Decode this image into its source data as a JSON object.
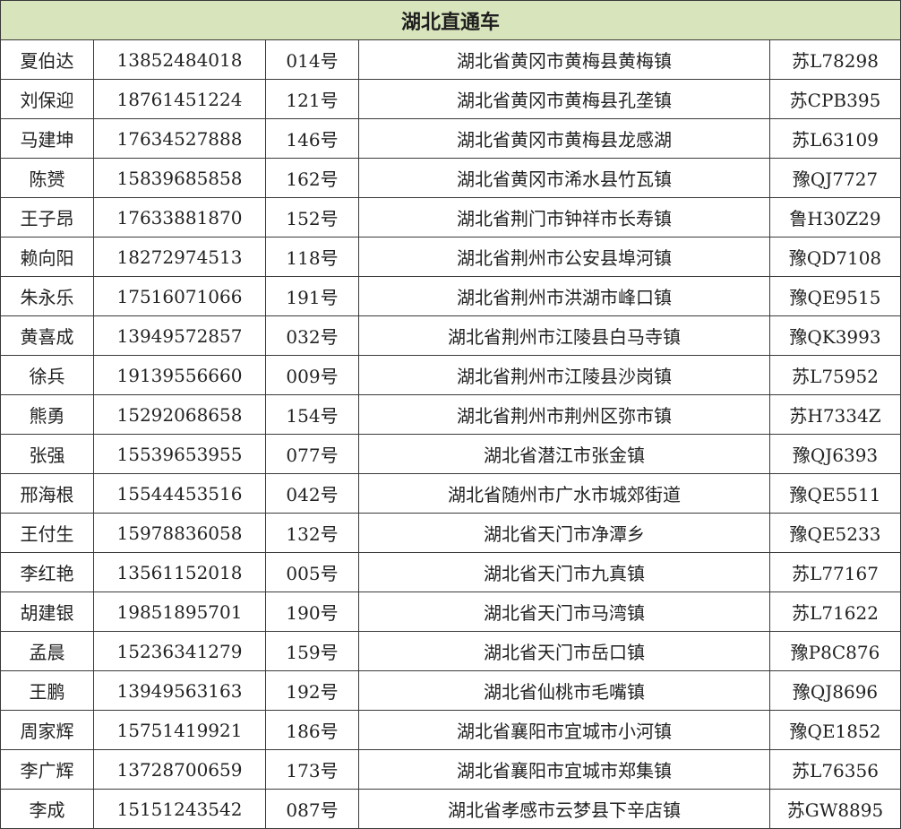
{
  "title": "湖北直通车",
  "rows": [
    {
      "name": "夏伯达",
      "phone": "13852484018",
      "number": "014号",
      "address": "湖北省黄冈市黄梅县黄梅镇",
      "plate": "苏L78298"
    },
    {
      "name": "刘保迎",
      "phone": "18761451224",
      "number": "121号",
      "address": "湖北省黄冈市黄梅县孔垄镇",
      "plate": "苏CPB395"
    },
    {
      "name": "马建坤",
      "phone": "17634527888",
      "number": "146号",
      "address": "湖北省黄冈市黄梅县龙感湖",
      "plate": "苏L63109"
    },
    {
      "name": "陈赟",
      "phone": "15839685858",
      "number": "162号",
      "address": "湖北省黄冈市浠水县竹瓦镇",
      "plate": "豫QJ7727"
    },
    {
      "name": "王子昂",
      "phone": "17633881870",
      "number": "152号",
      "address": "湖北省荆门市钟祥市长寿镇",
      "plate": "鲁H30Z29"
    },
    {
      "name": "赖向阳",
      "phone": "18272974513",
      "number": "118号",
      "address": "湖北省荆州市公安县埠河镇",
      "plate": "豫QD7108"
    },
    {
      "name": "朱永乐",
      "phone": "17516071066",
      "number": "191号",
      "address": "湖北省荆州市洪湖市峰口镇",
      "plate": "豫QE9515"
    },
    {
      "name": "黄喜成",
      "phone": "13949572857",
      "number": "032号",
      "address": "湖北省荆州市江陵县白马寺镇",
      "plate": "豫QK3993"
    },
    {
      "name": "徐兵",
      "phone": "19139556660",
      "number": "009号",
      "address": "湖北省荆州市江陵县沙岗镇",
      "plate": "苏L75952"
    },
    {
      "name": "熊勇",
      "phone": "15292068658",
      "number": "154号",
      "address": "湖北省荆州市荆州区弥市镇",
      "plate": "苏H7334Z"
    },
    {
      "name": "张强",
      "phone": "15539653955",
      "number": "077号",
      "address": "湖北省潜江市张金镇",
      "plate": "豫QJ6393"
    },
    {
      "name": "邢海根",
      "phone": "15544453516",
      "number": "042号",
      "address": "湖北省随州市广水市城郊街道",
      "plate": "豫QE5511"
    },
    {
      "name": "王付生",
      "phone": "15978836058",
      "number": "132号",
      "address": "湖北省天门市净潭乡",
      "plate": "豫QE5233"
    },
    {
      "name": "李红艳",
      "phone": "13561152018",
      "number": "005号",
      "address": "湖北省天门市九真镇",
      "plate": "苏L77167"
    },
    {
      "name": "胡建银",
      "phone": "19851895701",
      "number": "190号",
      "address": "湖北省天门市马湾镇",
      "plate": "苏L71622"
    },
    {
      "name": "孟晨",
      "phone": "15236341279",
      "number": "159号",
      "address": "湖北省天门市岳口镇",
      "plate": "豫P8C876"
    },
    {
      "name": "王鹏",
      "phone": "13949563163",
      "number": "192号",
      "address": "湖北省仙桃市毛嘴镇",
      "plate": "豫QJ8696"
    },
    {
      "name": "周家辉",
      "phone": "15751419921",
      "number": "186号",
      "address": "湖北省襄阳市宜城市小河镇",
      "plate": "豫QE1852"
    },
    {
      "name": "李广辉",
      "phone": "13728700659",
      "number": "173号",
      "address": "湖北省襄阳市宜城市郑集镇",
      "plate": "苏L76356"
    },
    {
      "name": "李成",
      "phone": "15151243542",
      "number": "087号",
      "address": "湖北省孝感市云梦县下辛店镇",
      "plate": "苏GW8895"
    }
  ]
}
